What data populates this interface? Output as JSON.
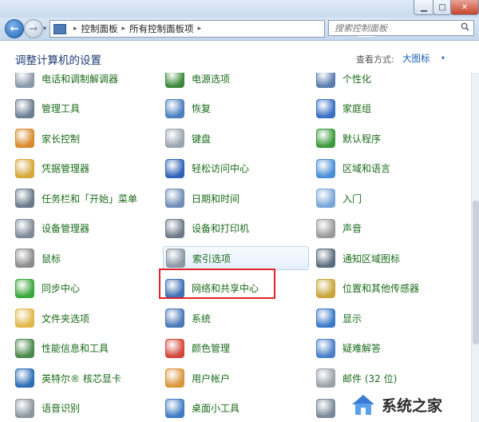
{
  "titlebar": {
    "min_glyph": "▁",
    "max_glyph": "□",
    "close_glyph": "✕"
  },
  "nav": {
    "back_glyph": "←",
    "forward_glyph": "→",
    "dropdown_glyph": "▾",
    "breadcrumb": [
      "控制面板",
      "所有控制面板项"
    ],
    "separator_glyph": "▸",
    "refresh_glyph": "↻"
  },
  "search": {
    "placeholder": "搜索控制面板"
  },
  "header": {
    "title": "调整计算机的设置",
    "view_label": "查看方式:",
    "view_value": "大图标",
    "view_dropdown_glyph": "▾"
  },
  "items": [
    {
      "label": "电话和调制解调器",
      "icon": "phone-modem-icon",
      "color": "#8a9aaa"
    },
    {
      "label": "电源选项",
      "icon": "power-icon",
      "color": "#3c8a3c"
    },
    {
      "label": "个性化",
      "icon": "personalize-icon",
      "color": "#5a7db0"
    },
    {
      "label": "管理工具",
      "icon": "admin-tools-icon",
      "color": "#6d7f93"
    },
    {
      "label": "恢复",
      "icon": "recovery-icon",
      "color": "#4b7fc0"
    },
    {
      "label": "家庭组",
      "icon": "homegroup-icon",
      "color": "#3a6fc4"
    },
    {
      "label": "家长控制",
      "icon": "parental-control-icon",
      "color": "#d98a2b"
    },
    {
      "label": "键盘",
      "icon": "keyboard-icon",
      "color": "#9aa4ae"
    },
    {
      "label": "默认程序",
      "icon": "default-programs-icon",
      "color": "#3b9a3b"
    },
    {
      "label": "凭据管理器",
      "icon": "credential-icon",
      "color": "#d6a83a"
    },
    {
      "label": "轻松访问中心",
      "icon": "ease-access-icon",
      "color": "#2f63b8"
    },
    {
      "label": "区域和语言",
      "icon": "region-language-icon",
      "color": "#4a8ed8"
    },
    {
      "label": "任务栏和「开始」菜单",
      "icon": "taskbar-icon",
      "color": "#6a7a8c"
    },
    {
      "label": "日期和时间",
      "icon": "date-time-icon",
      "color": "#6f8fb8"
    },
    {
      "label": "入门",
      "icon": "getting-started-icon",
      "color": "#7aa6d8"
    },
    {
      "label": "设备管理器",
      "icon": "device-manager-icon",
      "color": "#7d8a98"
    },
    {
      "label": "设备和打印机",
      "icon": "printer-icon",
      "color": "#6f7a88"
    },
    {
      "label": "声音",
      "icon": "sound-icon",
      "color": "#9a9a9a"
    },
    {
      "label": "鼠标",
      "icon": "mouse-icon",
      "color": "#8c8c8c"
    },
    {
      "label": "索引选项",
      "icon": "indexing-icon",
      "color": "#8a97a6"
    },
    {
      "label": "通知区域图标",
      "icon": "notification-icon",
      "color": "#5c6c7e"
    },
    {
      "label": "同步中心",
      "icon": "sync-icon",
      "color": "#3aa83a"
    },
    {
      "label": "网络和共享中心",
      "icon": "network-sharing-icon",
      "color": "#3f6fb5"
    },
    {
      "label": "位置和其他传感器",
      "icon": "location-sensor-icon",
      "color": "#c9a43a"
    },
    {
      "label": "文件夹选项",
      "icon": "folder-options-icon",
      "color": "#e0b84a"
    },
    {
      "label": "系统",
      "icon": "system-icon",
      "color": "#4a78b8"
    },
    {
      "label": "显示",
      "icon": "display-icon",
      "color": "#3d7ac8"
    },
    {
      "label": "性能信息和工具",
      "icon": "performance-icon",
      "color": "#4c8a4c"
    },
    {
      "label": "颜色管理",
      "icon": "color-management-icon",
      "color": "#d4453a"
    },
    {
      "label": "疑难解答",
      "icon": "troubleshooting-icon",
      "color": "#4a80c8"
    },
    {
      "label": "英特尔® 核芯显卡",
      "icon": "intel-graphics-icon",
      "color": "#2c6fb8"
    },
    {
      "label": "用户帐户",
      "icon": "user-accounts-icon",
      "color": "#d9953a"
    },
    {
      "label": "邮件 (32 位)",
      "icon": "mail-icon",
      "color": "#9aa2ab"
    },
    {
      "label": "语音识别",
      "icon": "speech-recognition-icon",
      "color": "#8d96a0"
    },
    {
      "label": "桌面小工具",
      "icon": "gadgets-icon",
      "color": "#3f7cc4"
    },
    {
      "label": "",
      "icon": "partial-icon",
      "color": "#7a8a9a"
    }
  ],
  "watermark": {
    "text": "系统之家"
  },
  "colors": {
    "link_green": "#1a6b1a",
    "title_blue": "#1c3a72",
    "highlight_red": "#e0232a"
  }
}
